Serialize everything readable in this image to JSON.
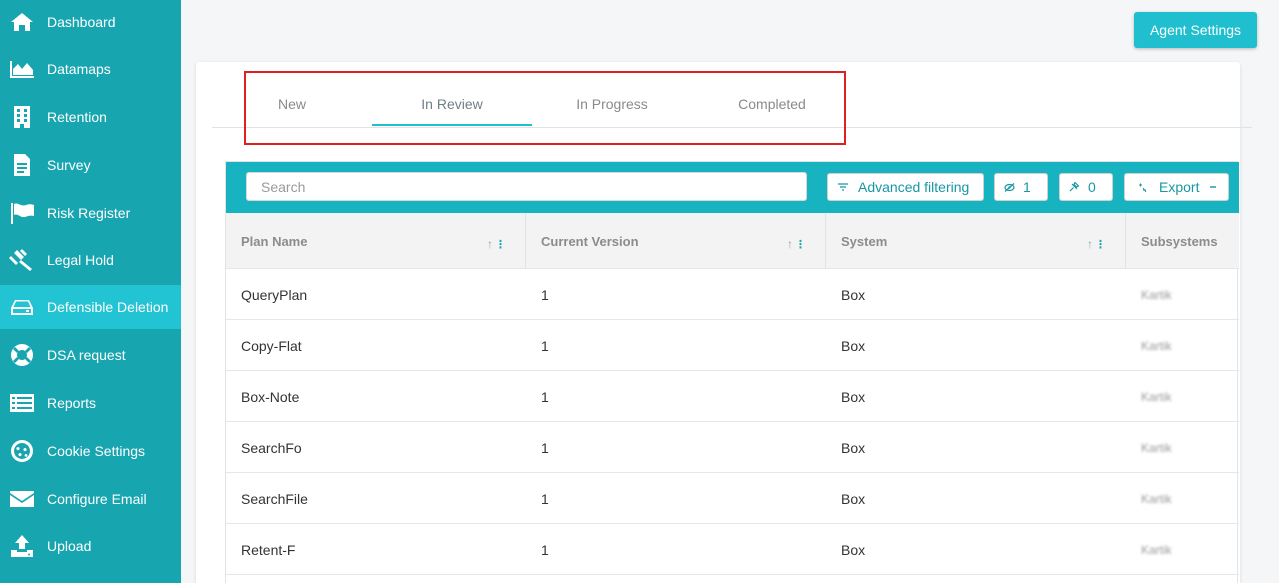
{
  "sidebar": {
    "items": [
      {
        "label": "Dashboard",
        "icon": "home-icon"
      },
      {
        "label": "Datamaps",
        "icon": "area-chart-icon"
      },
      {
        "label": "Retention",
        "icon": "building-icon"
      },
      {
        "label": "Survey",
        "icon": "document-icon"
      },
      {
        "label": "Risk Register",
        "icon": "flag-icon"
      },
      {
        "label": "Legal Hold",
        "icon": "gavel-icon"
      },
      {
        "label": "Defensible Deletion",
        "icon": "hard-drive-icon",
        "active": true
      },
      {
        "label": "DSA request",
        "icon": "life-ring-icon"
      },
      {
        "label": "Reports",
        "icon": "list-icon"
      },
      {
        "label": "Cookie Settings",
        "icon": "cookie-icon"
      },
      {
        "label": "Configure Email",
        "icon": "envelope-icon"
      },
      {
        "label": "Upload",
        "icon": "upload-icon"
      }
    ]
  },
  "header": {
    "agent_settings_label": "Agent Settings"
  },
  "tabs": [
    {
      "label": "New"
    },
    {
      "label": "In Review",
      "active": true
    },
    {
      "label": "In Progress"
    },
    {
      "label": "Completed"
    }
  ],
  "toolbar": {
    "search_placeholder": "Search",
    "advanced_filtering_label": "Advanced filtering",
    "hidden_count": "1",
    "pinned_count": "0",
    "export_label": "Export"
  },
  "table": {
    "columns": [
      "Plan Name",
      "Current Version",
      "System",
      "Subsystems"
    ],
    "rows": [
      {
        "plan": "QueryPlan",
        "version": "1",
        "system": "Box",
        "subsystems": "Kartik"
      },
      {
        "plan": "Copy-Flat",
        "version": "1",
        "system": "Box",
        "subsystems": "Kartik"
      },
      {
        "plan": "Box-Note",
        "version": "1",
        "system": "Box",
        "subsystems": "Kartik"
      },
      {
        "plan": "SearchFo",
        "version": "1",
        "system": "Box",
        "subsystems": "Kartik"
      },
      {
        "plan": "SearchFile",
        "version": "1",
        "system": "Box",
        "subsystems": "Kartik"
      },
      {
        "plan": "Retent-F",
        "version": "1",
        "system": "Box",
        "subsystems": "Kartik"
      }
    ]
  },
  "colors": {
    "sidebar": "#17a5b0",
    "active": "#22c3d2",
    "accent": "#1fbfcf",
    "highlight": "#e02020"
  }
}
